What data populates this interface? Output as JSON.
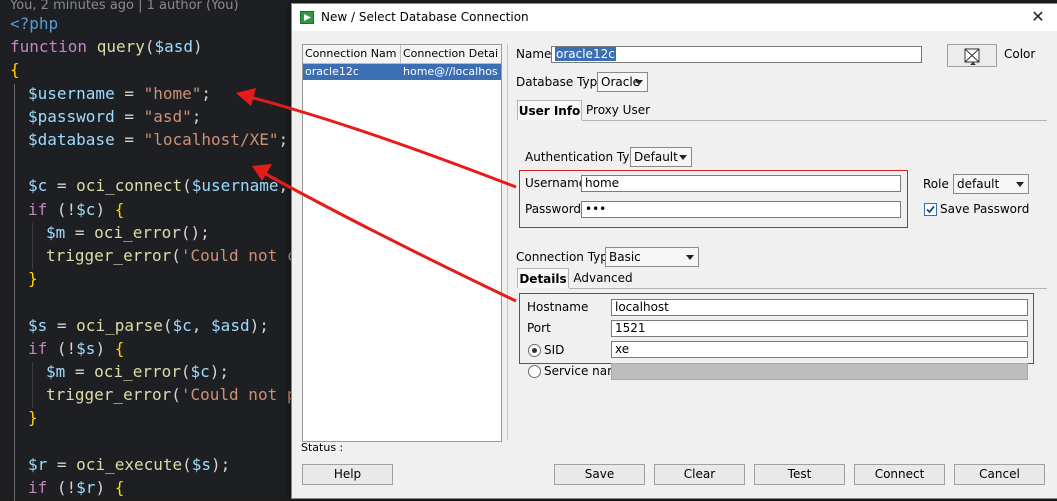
{
  "editor": {
    "blame": "You, 2 minutes ago | 1 author (You)",
    "colors": {
      "background": "#1e1f22",
      "tag": "#569cd6",
      "keyword": "#c586c0",
      "function": "#dcdcaa",
      "variable": "#9cdcfe",
      "string": "#ce9178",
      "brace": "#ffd700"
    },
    "lines": [
      {
        "text": "<?php",
        "kind": "tag",
        "indent": 0
      },
      {
        "text": "function query($asd)",
        "kind": "function-decl",
        "indent": 0
      },
      {
        "text": "{",
        "kind": "brace",
        "indent": 0
      },
      {
        "text": "$username = \"home\";",
        "kind": "assign",
        "indent": 1
      },
      {
        "text": "$password = \"asd\";",
        "kind": "assign",
        "indent": 1
      },
      {
        "text": "$database = \"localhost/XE\";",
        "kind": "assign",
        "indent": 1
      },
      {
        "text": "",
        "kind": "blank",
        "indent": 1
      },
      {
        "text": "$c = oci_connect($username, $",
        "kind": "code",
        "indent": 1
      },
      {
        "text": "if (!$c) {",
        "kind": "code",
        "indent": 1
      },
      {
        "text": "$m = oci_error();",
        "kind": "code",
        "indent": 2
      },
      {
        "text": "trigger_error('Could not co",
        "kind": "code",
        "indent": 2
      },
      {
        "text": "}",
        "kind": "code",
        "indent": 1
      },
      {
        "text": "",
        "kind": "blank",
        "indent": 1
      },
      {
        "text": "$s = oci_parse($c, $asd);",
        "kind": "code",
        "indent": 1
      },
      {
        "text": "if (!$s) {",
        "kind": "code",
        "indent": 1
      },
      {
        "text": "$m = oci_error($c);",
        "kind": "code",
        "indent": 2
      },
      {
        "text": "trigger_error('Could not pa",
        "kind": "code",
        "indent": 2
      },
      {
        "text": "}",
        "kind": "code",
        "indent": 1
      },
      {
        "text": "",
        "kind": "blank",
        "indent": 1
      },
      {
        "text": "$r = oci_execute($s);",
        "kind": "code",
        "indent": 1
      },
      {
        "text": "if (!$r) {",
        "kind": "code",
        "indent": 1
      }
    ]
  },
  "dialog": {
    "title": "New / Select Database Connection",
    "close_icon": "close-icon",
    "connections": {
      "headers": [
        "Connection Name",
        "Connection Details"
      ],
      "rows": [
        {
          "name": "oracle12c",
          "details": "home@//localhos..."
        }
      ],
      "selected_color": "#3c6eb4"
    },
    "form": {
      "name_label": "Name",
      "name_value": "oracle12c",
      "color_label": "Color",
      "db_type_label": "Database Type",
      "db_type_value": "Oracle",
      "tabs": [
        "User Info",
        "Proxy User"
      ],
      "active_tab": "User Info",
      "auth_type_label": "Authentication Type",
      "auth_type_value": "Default",
      "username_label": "Username",
      "username_value": "home",
      "password_label": "Password",
      "password_value": "•••",
      "role_label": "Role",
      "role_value": "default",
      "save_password_label": "Save Password",
      "save_password_checked": true,
      "conn_type_label": "Connection Type",
      "conn_type_value": "Basic",
      "detail_tabs": [
        "Details",
        "Advanced"
      ],
      "active_detail_tab": "Details",
      "hostname_label": "Hostname",
      "hostname_value": "localhost",
      "port_label": "Port",
      "port_value": "1521",
      "sid_label": "SID",
      "sid_value": "xe",
      "sid_selected": true,
      "service_name_label": "Service name",
      "service_name_value": ""
    },
    "status_label": "Status :",
    "buttons": [
      "Help",
      "Save",
      "Clear",
      "Test",
      "Connect",
      "Cancel"
    ],
    "highlight_color": "#d42020"
  }
}
